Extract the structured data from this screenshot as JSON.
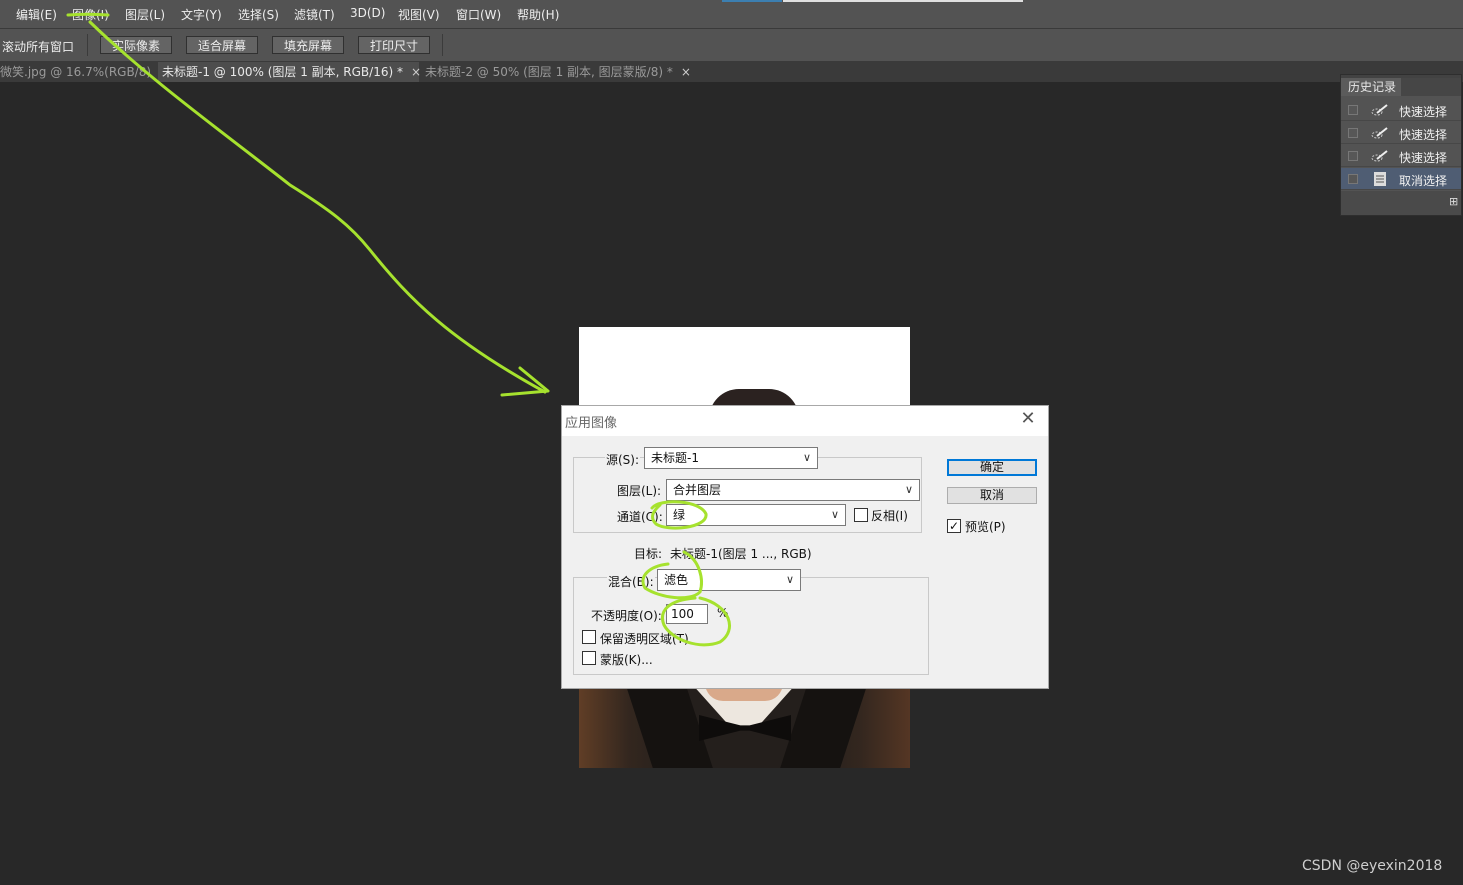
{
  "menubar": {
    "items": [
      "编辑(E)",
      "图像(I)",
      "图层(L)",
      "文字(Y)",
      "选择(S)",
      "滤镜(T)",
      "3D(D)",
      "视图(V)",
      "窗口(W)",
      "帮助(H)"
    ]
  },
  "options_bar": {
    "scroll_all_windows": "滚动所有窗口",
    "buttons": [
      "实际像素",
      "适合屏幕",
      "填充屏幕",
      "打印尺寸"
    ]
  },
  "tabs": [
    {
      "label": "微笑.jpg @ 16.7%(RGB/8)",
      "close": "×"
    },
    {
      "label": "未标题-1 @ 100% (图层 1 副本, RGB/16) *",
      "close": "×"
    },
    {
      "label": "未标题-2 @ 50% (图层 1 副本, 图层蒙版/8) *",
      "close": "×"
    }
  ],
  "history_panel": {
    "title": "历史记录",
    "items": [
      {
        "label": "快速选择",
        "icon": "quick-select-brush-icon",
        "selected": false
      },
      {
        "label": "快速选择",
        "icon": "quick-select-brush-icon",
        "selected": false
      },
      {
        "label": "快速选择",
        "icon": "quick-select-brush-icon",
        "selected": false
      },
      {
        "label": "取消选择",
        "icon": "document-icon",
        "selected": true
      }
    ]
  },
  "apply_image_dialog": {
    "title": "应用图像",
    "source_label": "源(S):",
    "source_value": "未标题-1",
    "layer_label": "图层(L):",
    "layer_value": "合并图层",
    "channel_label": "通道(C):",
    "channel_value": "绿",
    "invert_label": "反相(I)",
    "target_label": "目标:",
    "target_value": "未标题-1(图层 1 ..., RGB)",
    "blending_label": "混合(B):",
    "blending_value": "滤色",
    "opacity_label": "不透明度(O):",
    "opacity_value": "100",
    "opacity_unit": "%",
    "preserve_transparency_label": "保留透明区域(T)",
    "mask_label": "蒙版(K)...",
    "ok_label": "确定",
    "cancel_label": "取消",
    "preview_label": "预览(P)",
    "preview_checked": "✓"
  },
  "watermark": "CSDN @eyexin2018",
  "annotation_color": "#a6e22e"
}
